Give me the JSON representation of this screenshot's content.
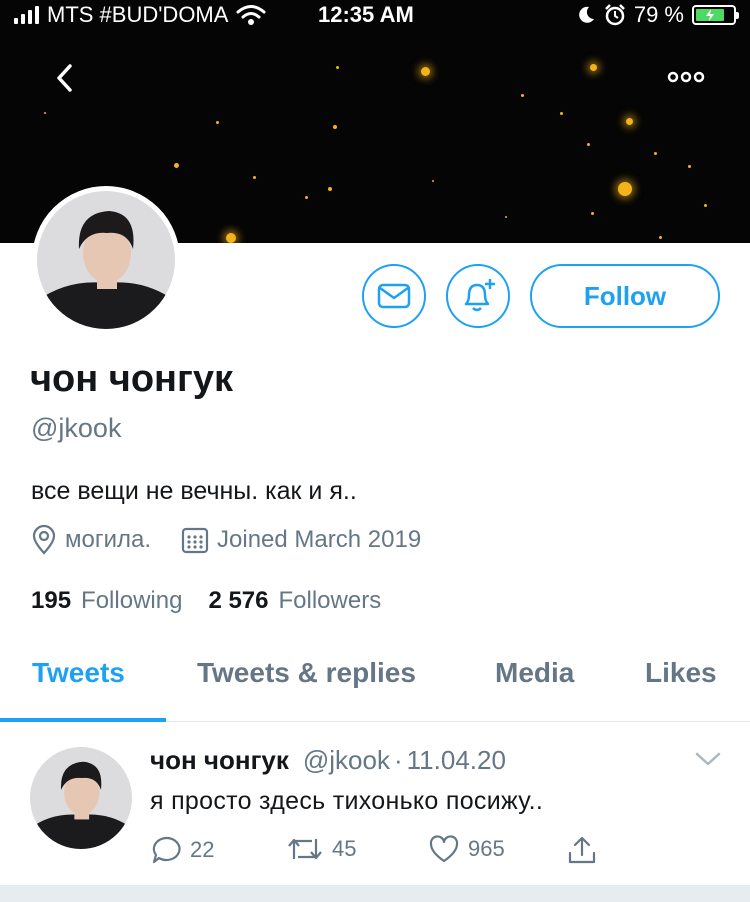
{
  "status_bar": {
    "carrier": "MTS #BUD'DOMA",
    "time": "12:35 AM",
    "battery_percent": "79 %",
    "battery_level": 0.79,
    "icons": [
      "signal-icon",
      "wifi-icon",
      "moon-icon",
      "alarm-icon",
      "battery-icon"
    ]
  },
  "header": {
    "back_icon": "chevron-left-icon",
    "more_icon": "more-dots-icon"
  },
  "profile": {
    "display_name": "чон чонгук",
    "handle": "@jkook",
    "bio": "все вещи не вечны. как и я..",
    "location": "могила.",
    "joined": "Joined March 2019",
    "following_count": "195",
    "following_label": "Following",
    "followers_count": "2 576",
    "followers_label": "Followers"
  },
  "actions": {
    "message_icon": "envelope-icon",
    "notify_icon": "bell-plus-icon",
    "follow_label": "Follow"
  },
  "tabs": [
    {
      "label": "Tweets",
      "active": true
    },
    {
      "label": "Tweets & replies",
      "active": false
    },
    {
      "label": "Media",
      "active": false
    },
    {
      "label": "Likes",
      "active": false
    }
  ],
  "tweet": {
    "author_name": "чон чонгук",
    "author_handle": "@jkook",
    "separator": "·",
    "date": "11.04.20",
    "text": "я просто здесь тихонько посижу..",
    "replies": "22",
    "retweets": "45",
    "likes": "965"
  },
  "colors": {
    "accent": "#1da1f2",
    "muted": "#657786",
    "text": "#14171a",
    "banner": "#050505",
    "star": "#f5b31a",
    "battery_fill": "#4cd964"
  }
}
